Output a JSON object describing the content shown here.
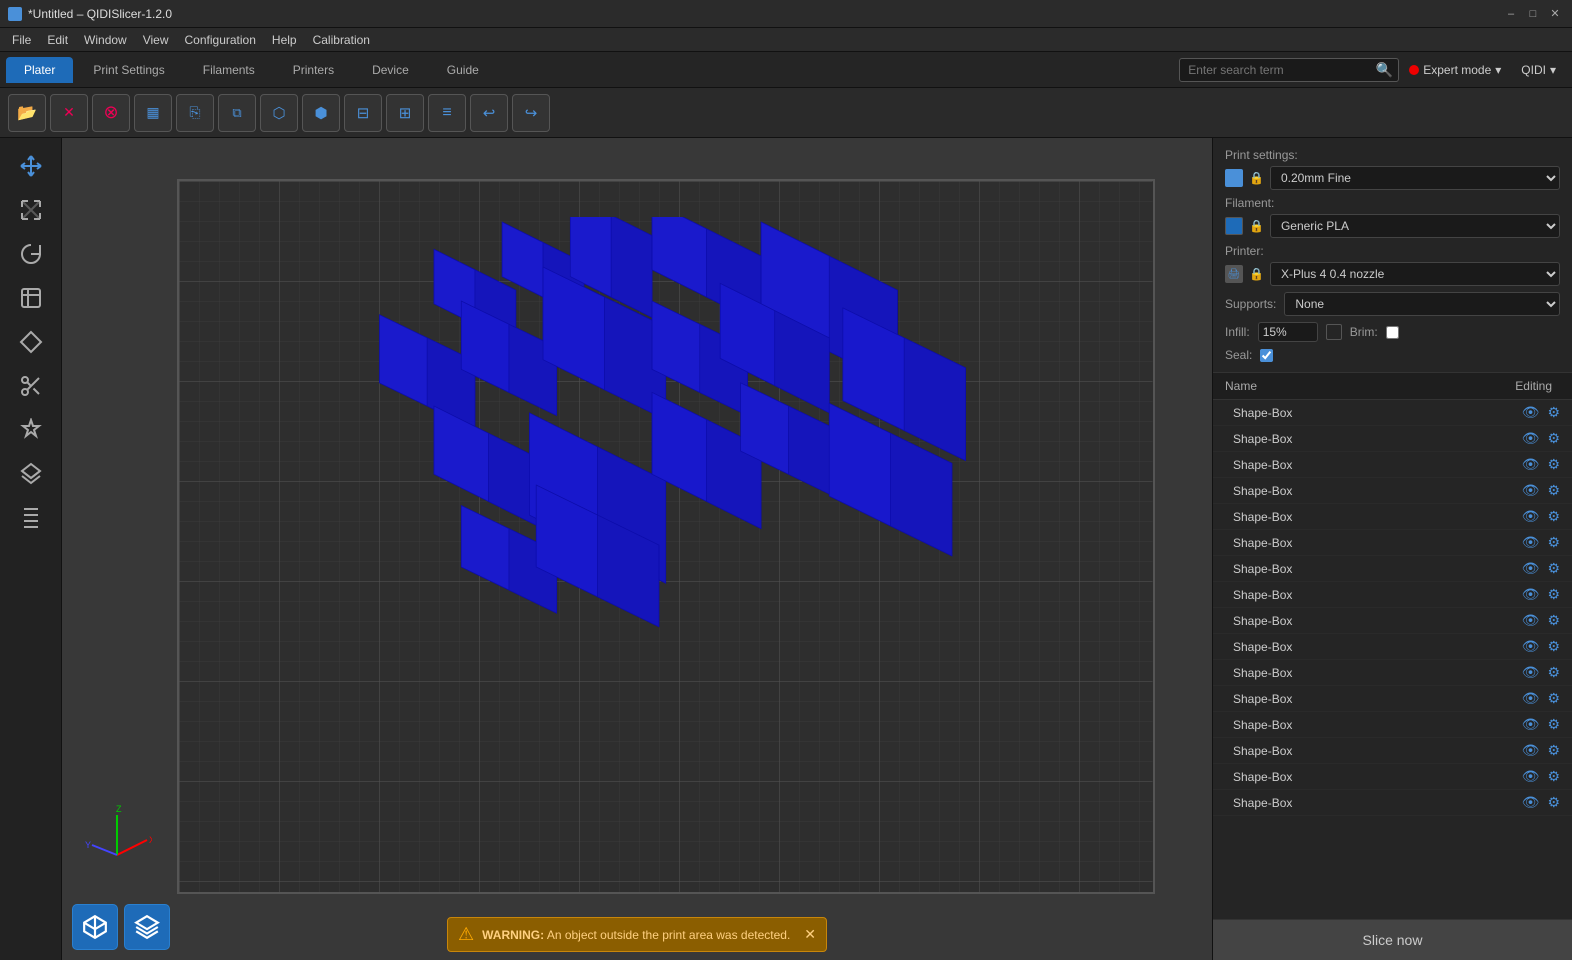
{
  "titlebar": {
    "title": "*Untitled – QIDISlicer-1.2.0",
    "minimize": "–",
    "maximize": "□",
    "close": "✕"
  },
  "menubar": {
    "items": [
      "File",
      "Edit",
      "Window",
      "View",
      "Configuration",
      "Help",
      "Calibration"
    ]
  },
  "tabs": {
    "items": [
      "Plater",
      "Print Settings",
      "Filaments",
      "Printers",
      "Device",
      "Guide"
    ],
    "active": "Plater"
  },
  "search": {
    "placeholder": "Enter search term"
  },
  "expert_mode": {
    "label": "Expert mode",
    "chevron": "▾"
  },
  "qidi": {
    "label": "QIDI",
    "chevron": "▾"
  },
  "toolbar": {
    "buttons": [
      {
        "name": "open-folder",
        "icon": "📂"
      },
      {
        "name": "delete",
        "icon": "✕"
      },
      {
        "name": "cancel",
        "icon": "⊘"
      },
      {
        "name": "grid",
        "icon": "▦"
      },
      {
        "name": "copy",
        "icon": "⎘"
      },
      {
        "name": "multi-copy",
        "icon": "⧉"
      },
      {
        "name": "3d-view",
        "icon": "⬡"
      },
      {
        "name": "explode",
        "icon": "⬢"
      },
      {
        "name": "split-h",
        "icon": "⊟"
      },
      {
        "name": "split-v",
        "icon": "⊞"
      },
      {
        "name": "list",
        "icon": "≡"
      },
      {
        "name": "undo",
        "icon": "↩"
      },
      {
        "name": "redo",
        "icon": "↪"
      }
    ]
  },
  "left_tools": [
    {
      "name": "move",
      "icon": "✛"
    },
    {
      "name": "scale",
      "icon": "⤢"
    },
    {
      "name": "rotate",
      "icon": "↻"
    },
    {
      "name": "place-face",
      "icon": "⬡"
    },
    {
      "name": "paint",
      "icon": "◆"
    },
    {
      "name": "cut",
      "icon": "✂"
    },
    {
      "name": "support-paint",
      "icon": "◇"
    },
    {
      "name": "add-object",
      "icon": "⬡"
    },
    {
      "name": "arrange",
      "icon": "⤡"
    }
  ],
  "print_settings": {
    "label": "Print settings:",
    "profile": "0.20mm Fine",
    "filament_label": "Filament:",
    "filament": "Generic PLA",
    "printer_label": "Printer:",
    "printer": "X-Plus 4 0.4 nozzle",
    "supports_label": "Supports:",
    "supports": "None",
    "infill_label": "Infill:",
    "infill_value": "15%",
    "brim_label": "Brim:",
    "seal_label": "Seal:"
  },
  "objects_header": {
    "name_col": "Name",
    "editing_col": "Editing"
  },
  "objects": [
    {
      "name": "Shape-Box"
    },
    {
      "name": "Shape-Box"
    },
    {
      "name": "Shape-Box"
    },
    {
      "name": "Shape-Box"
    },
    {
      "name": "Shape-Box"
    },
    {
      "name": "Shape-Box"
    },
    {
      "name": "Shape-Box"
    },
    {
      "name": "Shape-Box"
    },
    {
      "name": "Shape-Box"
    },
    {
      "name": "Shape-Box"
    },
    {
      "name": "Shape-Box"
    },
    {
      "name": "Shape-Box"
    },
    {
      "name": "Shape-Box"
    },
    {
      "name": "Shape-Box"
    },
    {
      "name": "Shape-Box"
    },
    {
      "name": "Shape-Box"
    }
  ],
  "slice_btn": "Slice now",
  "warning": {
    "text": "WARNING:",
    "detail": "An object outside the print area was detected.",
    "icon": "⚠"
  },
  "colors": {
    "accent": "#1e6bb8",
    "cube_blue": "#1a1aee",
    "cube_dark": "#0d0dcc",
    "cube_side": "#1212bb"
  }
}
